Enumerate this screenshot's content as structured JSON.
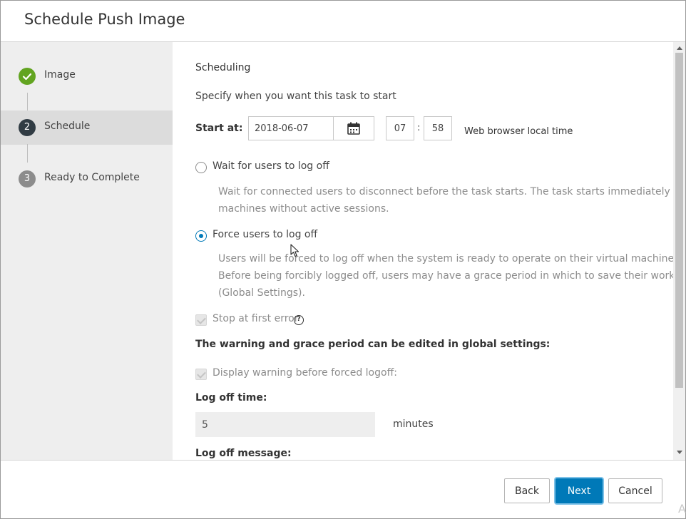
{
  "dialog": {
    "title": "Schedule Push Image"
  },
  "steps": [
    {
      "number": "",
      "label": "Image",
      "state": "done"
    },
    {
      "number": "2",
      "label": "Schedule",
      "state": "current"
    },
    {
      "number": "3",
      "label": "Ready to Complete",
      "state": "pending"
    }
  ],
  "form": {
    "section_title": "Scheduling",
    "intro": "Specify when you want this task to start",
    "start_label": "Start at:",
    "date_value": "2018-06-07",
    "hour_value": "07",
    "minute_value": "58",
    "time_separator": ":",
    "timezone_label": "Web browser local time",
    "wait_option": {
      "label": "Wait for users to log off",
      "description_line1": "Wait for connected users to disconnect before the task starts. The task starts immediately on",
      "description_line2": "machines without active sessions.",
      "selected": false
    },
    "force_option": {
      "label": "Force users to log off",
      "description_line1": "Users will be forced to log off when the system is ready to operate on their virtual machines.",
      "description_line2": "Before being forcibly logged off, users may have a grace period in which to save their work",
      "description_line3": "(Global Settings).",
      "selected": true
    },
    "stop_first_error": {
      "label": "Stop at first error",
      "checked": true,
      "disabled": true
    },
    "help_icon_glyph": "?",
    "warning_heading": "The warning and grace period can be edited in global settings:",
    "display_warning": {
      "label": "Display warning before forced logoff:",
      "checked": true,
      "disabled": true
    },
    "logoff_time_label": "Log off time:",
    "logoff_time_value": "5",
    "minutes_label": "minutes",
    "logoff_message_label": "Log off message:"
  },
  "footer": {
    "back_label": "Back",
    "next_label": "Next",
    "cancel_label": "Cancel"
  },
  "corner_glyph": "A",
  "colors": {
    "accent": "#0079b8",
    "step_done": "#62a420",
    "step_current": "#313c44",
    "step_pending": "#8c8c8c",
    "sidebar_bg": "#eeeeee"
  },
  "icons": {
    "step_done": "check-icon",
    "calendar": "calendar-icon",
    "help": "help-icon",
    "cursor": "mouse-cursor-icon"
  }
}
